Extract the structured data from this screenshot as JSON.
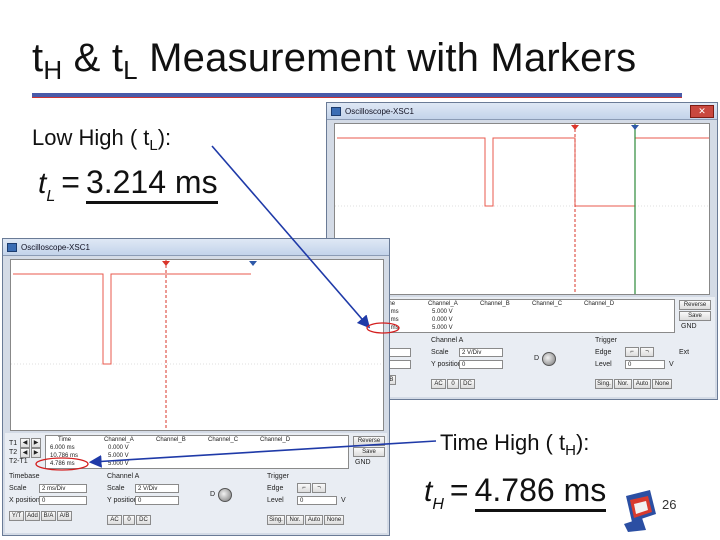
{
  "slide": {
    "title_pre": "t",
    "title_sub1": "H",
    "title_mid": " & t",
    "title_sub2": "L",
    "title_post": " Measurement with Markers",
    "page_number": "26"
  },
  "low_caption": {
    "pre": "Low High ( t",
    "sub": "L",
    "post": "):"
  },
  "low_formula": {
    "var": "t",
    "sub": "L",
    "eq": "=",
    "value": "3.214 ms"
  },
  "high_caption": {
    "pre": "Time High ( t",
    "sub": "H",
    "post": "):"
  },
  "high_formula": {
    "var": "t",
    "sub": "H",
    "eq": "=",
    "value": "4.786 ms"
  },
  "colors": {
    "trace": "#e8584c",
    "marker1": "#d9352a",
    "marker2": "#2e58a8",
    "arrow": "#1f3aa8",
    "ellipse": "#d41f1f"
  },
  "scope_window": {
    "title": "Oscilloscope-XSC1",
    "close_icon": "close-icon",
    "markers": {
      "t1_label": "T1",
      "t2_label": "T2",
      "diff_label": "T2-T1"
    },
    "table_headers": [
      "Time",
      "Channel_A",
      "Channel_B",
      "Channel_C",
      "Channel_D"
    ],
    "reverse_label": "Reverse",
    "save_label": "Save",
    "gnd_label": "GND",
    "timebase": {
      "label": "Timebase",
      "scale_label": "Scale",
      "scale_value": "2 ms/Div",
      "xpos_label": "X position",
      "xpos_value": "0",
      "buttons": [
        "Y/T",
        "Add",
        "B/A",
        "A/B"
      ]
    },
    "channel_a": {
      "label": "Channel A",
      "scale_label": "Scale",
      "scale_value": "2 V/Div",
      "ypos_label": "Y position",
      "ypos_value": "0",
      "buttons": [
        "AC",
        "0",
        "DC"
      ]
    },
    "trigger": {
      "label": "Trigger",
      "edge_label": "Edge",
      "level_label": "Level",
      "level_value": "0",
      "level_unit": "V",
      "ext_label": "Ext",
      "buttons": [
        "Sing.",
        "Nor.",
        "Auto",
        "None"
      ],
      "a_btn": "A",
      "b_btn": "B"
    }
  },
  "scope_top": {
    "rows": [
      {
        "time": "2.786 ms",
        "a": "5.000 V",
        "b": "",
        "c": "",
        "d": ""
      },
      {
        "time": "6.000 ms",
        "a": "0.000 V",
        "b": "",
        "c": "",
        "d": ""
      },
      {
        "time": "3.214 ms",
        "a": "5.000 V",
        "b": "",
        "c": "",
        "d": ""
      }
    ]
  },
  "scope_bottom": {
    "rows": [
      {
        "time": "6.000 ms",
        "a": "0.000 V",
        "b": "",
        "c": "",
        "d": ""
      },
      {
        "time": "10.786 ms",
        "a": "5.000 V",
        "b": "",
        "c": "",
        "d": ""
      },
      {
        "time": "4.786 ms",
        "a": "5.000 V",
        "b": "",
        "c": "",
        "d": ""
      }
    ]
  }
}
